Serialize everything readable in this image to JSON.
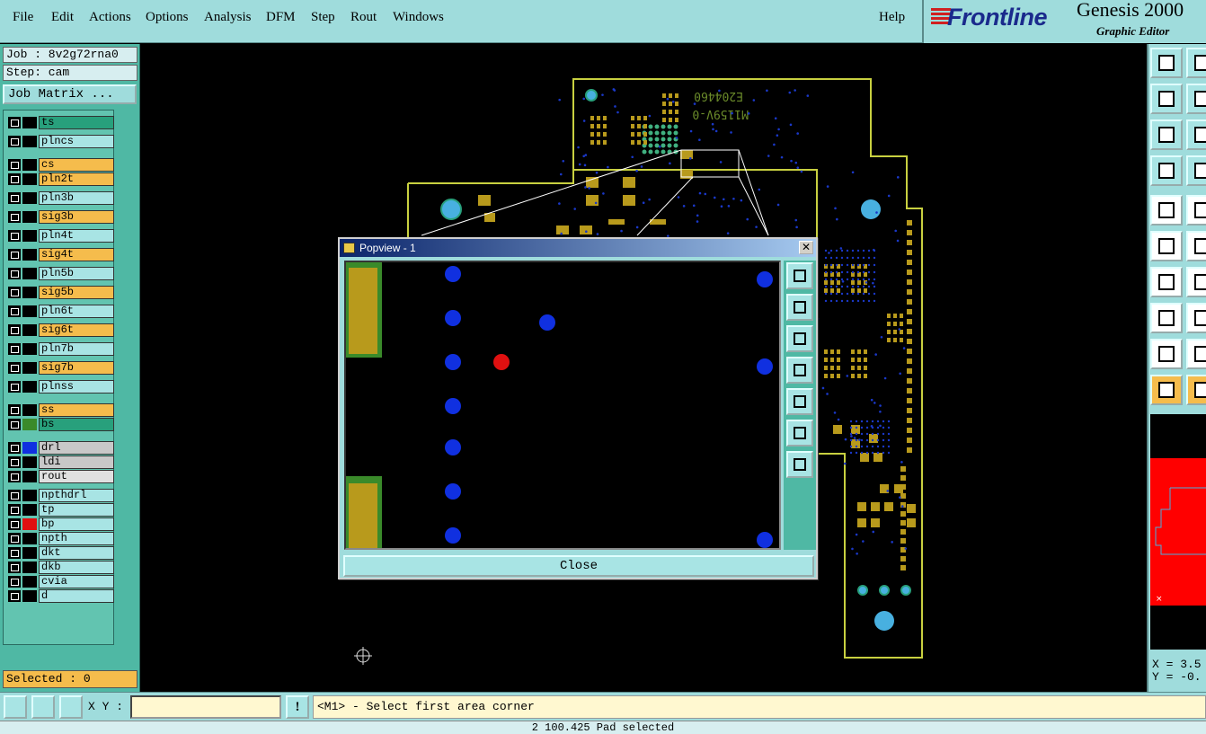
{
  "menu": {
    "file": "File",
    "edit": "Edit",
    "actions": "Actions",
    "options": "Options",
    "analysis": "Analysis",
    "dfm": "DFM",
    "step": "Step",
    "rout": "Rout",
    "windows": "Windows",
    "help": "Help"
  },
  "brand": {
    "logo": "Frontline",
    "product": "Genesis 2000",
    "subtitle": "Graphic Editor"
  },
  "job": {
    "job_line": "Job : 8v2g72rna0",
    "step_line": "Step: cam",
    "matrix_button": "Job Matrix ..."
  },
  "layers": [
    {
      "name": "ts",
      "bg": "#28a07c",
      "color": "#000000"
    },
    {
      "name": "plncs",
      "bg": "#a8e4e4",
      "color": "#000000"
    },
    {
      "name": "cs",
      "bg": "#f5bc4c",
      "color": "#000000"
    },
    {
      "name": "pln2t",
      "bg": "#f5bc4c",
      "color": "#000000"
    },
    {
      "name": "pln3b",
      "bg": "#a8e4e4",
      "color": "#000000"
    },
    {
      "name": "sig3b",
      "bg": "#f5bc4c",
      "color": "#000000"
    },
    {
      "name": "pln4t",
      "bg": "#a8e4e4",
      "color": "#000000"
    },
    {
      "name": "sig4t",
      "bg": "#f5bc4c",
      "color": "#000000"
    },
    {
      "name": "pln5b",
      "bg": "#a8e4e4",
      "color": "#000000"
    },
    {
      "name": "sig5b",
      "bg": "#f5bc4c",
      "color": "#000000"
    },
    {
      "name": "pln6t",
      "bg": "#a8e4e4",
      "color": "#000000"
    },
    {
      "name": "sig6t",
      "bg": "#f5bc4c",
      "color": "#000000"
    },
    {
      "name": "pln7b",
      "bg": "#a8e4e4",
      "color": "#000000"
    },
    {
      "name": "sig7b",
      "bg": "#f5bc4c",
      "color": "#000000"
    },
    {
      "name": "plnss",
      "bg": "#a8e4e4",
      "color": "#000000"
    },
    {
      "name": "ss",
      "bg": "#f5bc4c",
      "color": "#000000"
    },
    {
      "name": "bs",
      "bg": "#28a07c",
      "color": "#3a8a2a"
    },
    {
      "name": "drl",
      "bg": "#c8c8c8",
      "color": "#1030e0"
    },
    {
      "name": "ldi",
      "bg": "#c8c8c8",
      "color": "#000000"
    },
    {
      "name": "rout",
      "bg": "#e0e0e0",
      "color": "#000000"
    },
    {
      "name": "npthdrl",
      "bg": "#a8e4e4",
      "color": "#000000"
    },
    {
      "name": "tp",
      "bg": "#a8e4e4",
      "color": "#000000"
    },
    {
      "name": "bp",
      "bg": "#a8e4e4",
      "color": "#e01010"
    },
    {
      "name": "npth",
      "bg": "#a8e4e4",
      "color": "#000000"
    },
    {
      "name": "dkt",
      "bg": "#a8e4e4",
      "color": "#000000"
    },
    {
      "name": "dkb",
      "bg": "#a8e4e4",
      "color": "#000000"
    },
    {
      "name": "cvia",
      "bg": "#a8e4e4",
      "color": "#000000"
    },
    {
      "name": "d",
      "bg": "#a8e4e4",
      "color": "#000000"
    }
  ],
  "selected": "Selected : 0",
  "popview": {
    "title": "Popview - 1",
    "close_label": "Close"
  },
  "bottom": {
    "xy_label": "X Y :",
    "xy_value": "",
    "excl": "!",
    "status": "<M1> - Select first area corner",
    "footer": "2  100.425 Pad    selected"
  },
  "coords": {
    "x": "X = 3.5",
    "y": "Y = -0."
  },
  "board": {
    "silk_text_1": "E204460",
    "silk_text_2": "M1159V-0"
  },
  "colors": {
    "panel": "#9fdcdc",
    "copper": "#b89a1c",
    "drill": "#1030e0",
    "selected_pad": "#e01010",
    "outline": "#c8d040"
  }
}
